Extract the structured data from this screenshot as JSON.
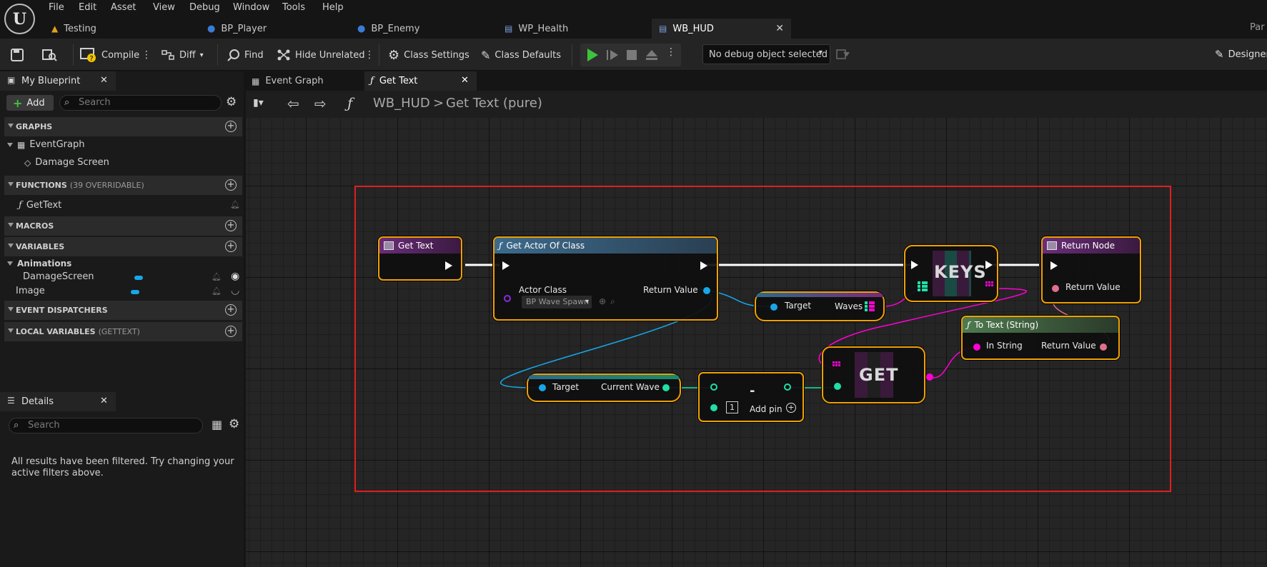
{
  "menu": {
    "items": [
      "File",
      "Edit",
      "Asset",
      "View",
      "Debug",
      "Window",
      "Tools",
      "Help"
    ],
    "logo_letter": "U"
  },
  "doc_tabs": [
    {
      "label": "Testing",
      "icon": "level-icon"
    },
    {
      "label": "BP_Player",
      "icon": "blueprint-icon"
    },
    {
      "label": "BP_Enemy",
      "icon": "blueprint-icon"
    },
    {
      "label": "WP_Health",
      "icon": "widget-blueprint-icon"
    },
    {
      "label": "WB_HUD",
      "icon": "widget-blueprint-icon",
      "active": true
    }
  ],
  "top_right_text": "Par",
  "toolbar": {
    "compile": "Compile",
    "diff": "Diff",
    "find": "Find",
    "hide_unrelated": "Hide Unrelated",
    "class_settings": "Class Settings",
    "class_defaults": "Class Defaults",
    "debug_object": "No debug object selected",
    "designer": "Designer"
  },
  "my_blueprint": {
    "tab_label": "My Blueprint",
    "add_label": "Add",
    "search_placeholder": "Search",
    "sections": {
      "graphs": "GRAPHS",
      "functions": "FUNCTIONS",
      "functions_note": "(39 OVERRIDABLE)",
      "macros": "MACROS",
      "variables": "VARIABLES",
      "event_dispatchers": "EVENT DISPATCHERS",
      "local_variables": "LOCAL VARIABLES",
      "local_variables_note": "(GETTEXT)"
    },
    "graphs": {
      "event_graph": "EventGraph",
      "damage_screen": "Damage Screen"
    },
    "functions": {
      "get_text": "GetText"
    },
    "variables": {
      "category": "Animations",
      "damage_screen": "DamageScreen",
      "image": "Image"
    }
  },
  "details": {
    "tab_label": "Details",
    "search_placeholder": "Search",
    "empty_message": "All results have been filtered. Try changing your active filters above."
  },
  "graph_tabs": [
    {
      "label": "Event Graph"
    },
    {
      "label": "Get Text",
      "active": true
    }
  ],
  "breadcrumb": {
    "root": "WB_HUD",
    "separator": ">",
    "current": "Get Text (pure)"
  },
  "nodes": {
    "get_text": {
      "title": "Get Text"
    },
    "get_actor_of_class": {
      "title": "Get Actor Of Class",
      "actor_class": "Actor Class",
      "actor_class_value": "BP Wave Spawn",
      "return_value": "Return Value"
    },
    "get_waves": {
      "target": "Target",
      "waves": "Waves"
    },
    "keys": {
      "label": "KEYS"
    },
    "return_node": {
      "title": "Return Node",
      "return_value": "Return Value"
    },
    "to_text": {
      "title": "To Text (String)",
      "in_string": "In String",
      "return_value": "Return Value"
    },
    "get_current_wave": {
      "target": "Target",
      "current_wave": "Current Wave"
    },
    "subtract": {
      "symbol": "-",
      "constant": "1",
      "add_pin": "Add pin"
    },
    "get_array": {
      "label": "GET"
    }
  },
  "colors": {
    "accent_orange": "#f0a000",
    "selection_red": "#e01e1e",
    "pin_object_blue": "#17a7e9",
    "pin_int_green": "#1fe0a6",
    "pin_string_magenta": "#ff00d4",
    "pin_text_pink": "#e0708a",
    "exec_white": "#ffffff",
    "function_header_blue": "#3d6b8c",
    "pure_header_green": "#4e7a4e",
    "entry_header_purple": "#6a2d78"
  }
}
